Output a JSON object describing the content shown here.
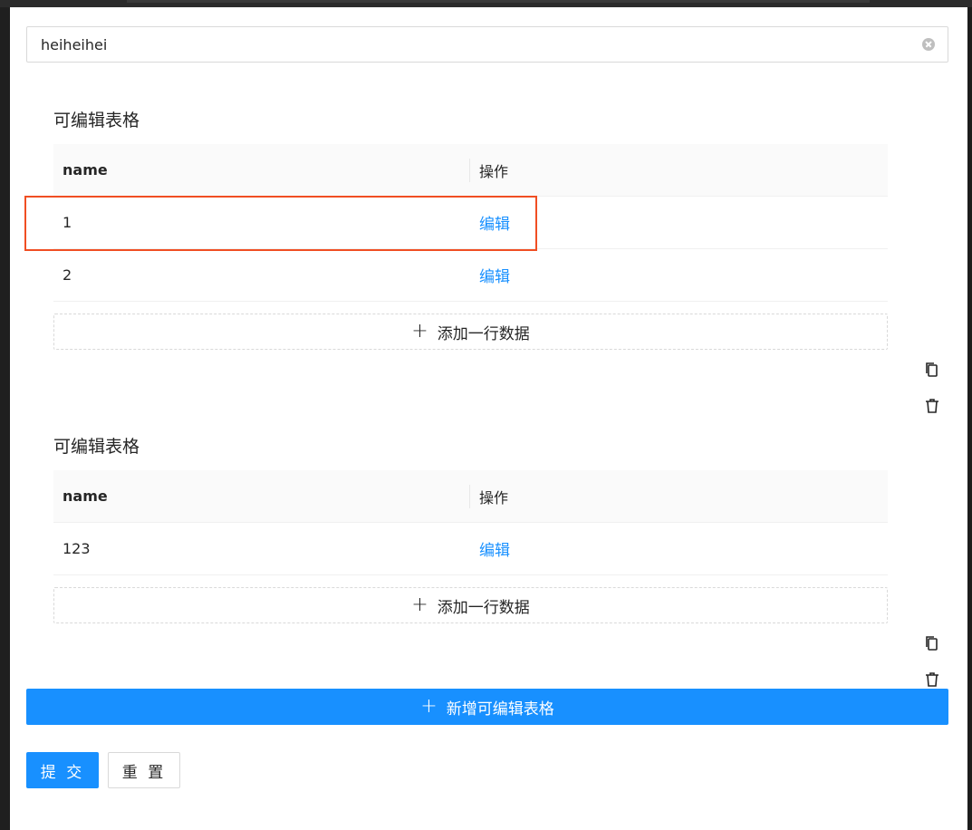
{
  "form": {
    "name_field": {
      "value": "heiheihei"
    },
    "tables": [
      {
        "title": "可编辑表格",
        "columns": {
          "name": "name",
          "action": "操作"
        },
        "rows": [
          {
            "name": "1",
            "action": "编辑"
          },
          {
            "name": "2",
            "action": "编辑"
          }
        ],
        "add_row_label": "添加一行数据"
      },
      {
        "title": "可编辑表格",
        "columns": {
          "name": "name",
          "action": "操作"
        },
        "rows": [
          {
            "name": "123",
            "action": "编辑"
          }
        ],
        "add_row_label": "添加一行数据"
      }
    ],
    "add_table_label": "新增可编辑表格",
    "submit_label": "提 交",
    "reset_label": "重 置"
  },
  "icons": {
    "copy": "copy-icon",
    "delete": "trash-icon",
    "clear": "clear-icon",
    "add": "plus-icon"
  },
  "colors": {
    "primary": "#1890ff",
    "highlight": "#f04e23",
    "header_bg": "#fafafa"
  }
}
